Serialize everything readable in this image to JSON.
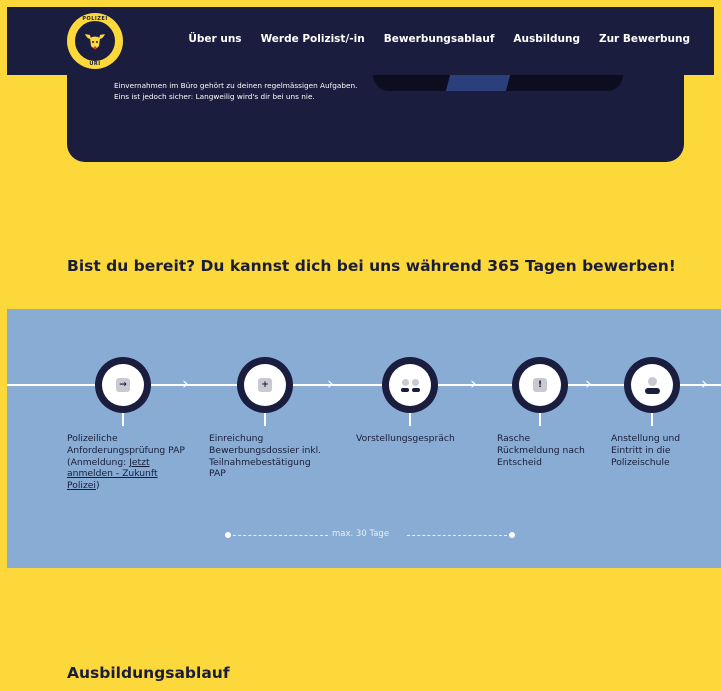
{
  "nav": {
    "logo_top_text": "POLIZEI",
    "logo_bottom_text": "URI",
    "links": [
      "Über uns",
      "Werde Polizist/-in",
      "Bewerbungsablauf",
      "Ausbildung",
      "Zur Bewerbung"
    ]
  },
  "hero": {
    "text": "Einvernahmen im Büro gehört zu deinen regelmässigen Aufgaben. Eins ist jedoch sicher: Langweilig wird's dir bei uns nie."
  },
  "cta": {
    "heading": "Bist du bereit? Du kannst dich bei uns während 365 Tagen bewerben!"
  },
  "process": {
    "steps": [
      {
        "icon": "arrow-right-icon",
        "label": "Polizeiliche Anforderungsprüfung PAP (Anmeldung: ",
        "link": "Jetzt anmelden - Zukunft Polizei",
        "label_end": ")"
      },
      {
        "icon": "document-add-icon",
        "label": "Einreichung Bewerbungsdossier inkl. Teilnahmebestätigung PAP"
      },
      {
        "icon": "people-icon",
        "label": "Vorstellungsgespräch"
      },
      {
        "icon": "exclamation-icon",
        "label": "Rasche Rückmeldung nach Entscheid"
      },
      {
        "icon": "user-add-icon",
        "label": "Anstellung und Eintritt in die Polizeischule"
      }
    ],
    "timeline_label": "max. 30 Tage"
  },
  "training": {
    "title": "Ausbildungsablauf"
  },
  "colors": {
    "page_background": "#fdd83b",
    "navy": "#1a1d3e",
    "process_background": "#88acd3",
    "white": "#ffffff"
  }
}
